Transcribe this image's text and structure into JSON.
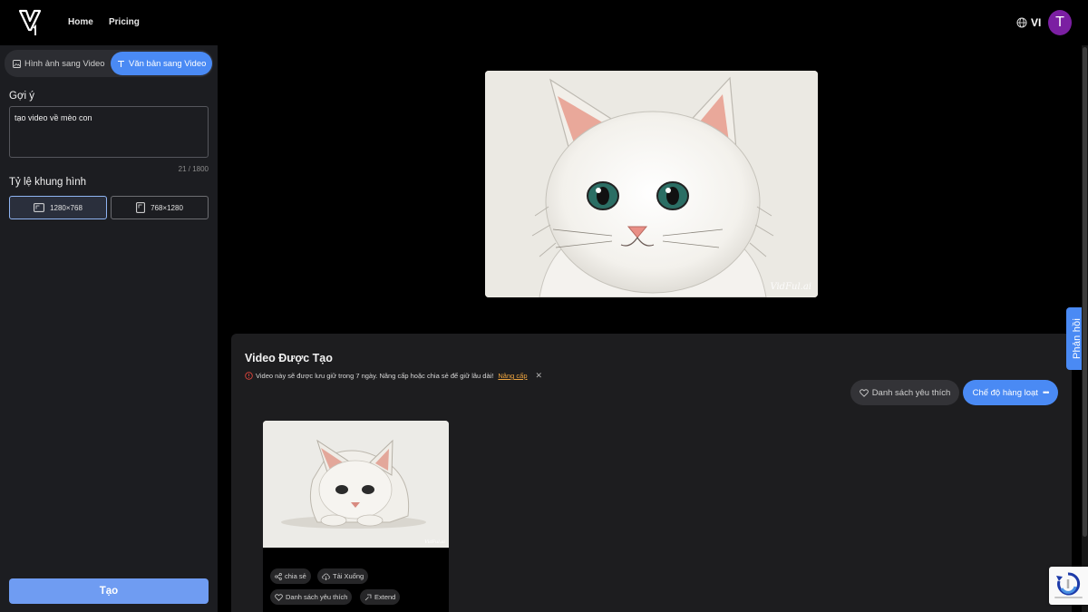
{
  "header": {
    "nav": [
      {
        "label": "Home"
      },
      {
        "label": "Pricing"
      }
    ],
    "language": "VI",
    "avatar_initial": "T"
  },
  "sidebar": {
    "modes": [
      {
        "label": "Hình ảnh sang Video",
        "active": false
      },
      {
        "label": "Văn bản sang Video",
        "active": true
      }
    ],
    "prompt_label": "Gợi ý",
    "prompt_value": "tạo video về mèo con",
    "char_count": "21 / 1800",
    "ratio_label": "Tỷ lệ khung hình",
    "ratios": [
      {
        "label": "1280×768",
        "selected": true
      },
      {
        "label": "768×1280",
        "selected": false
      }
    ],
    "create_label": "Tạo"
  },
  "preview": {
    "watermark": "VidFul.ai"
  },
  "created": {
    "title": "Video Được Tạo",
    "notice_text": "Video này sẽ được lưu giữ trong 7 ngày. Nâng cấp hoặc chia sẻ để giữ lâu dài!",
    "notice_link": "Nâng cấp",
    "favorites_label": "Danh sách yêu thích",
    "batch_label": "Chế độ hàng loạt",
    "card": {
      "watermark": "VidFul.ai",
      "actions": [
        {
          "label": "chia sẻ",
          "icon": "share-icon"
        },
        {
          "label": "Tải Xuống",
          "icon": "download-cloud-icon"
        },
        {
          "label": "Danh sách yêu thích",
          "icon": "heart-icon"
        },
        {
          "label": "Extend",
          "icon": "extend-icon"
        }
      ]
    }
  },
  "feedback_label": "Phản hồi",
  "colors": {
    "accent": "#4a8af4",
    "sidebar_bg": "#1c1d21",
    "panel_bg": "#1d1d1f",
    "avatar": "#7b1fa2",
    "upgrade_link": "#f0a640"
  }
}
